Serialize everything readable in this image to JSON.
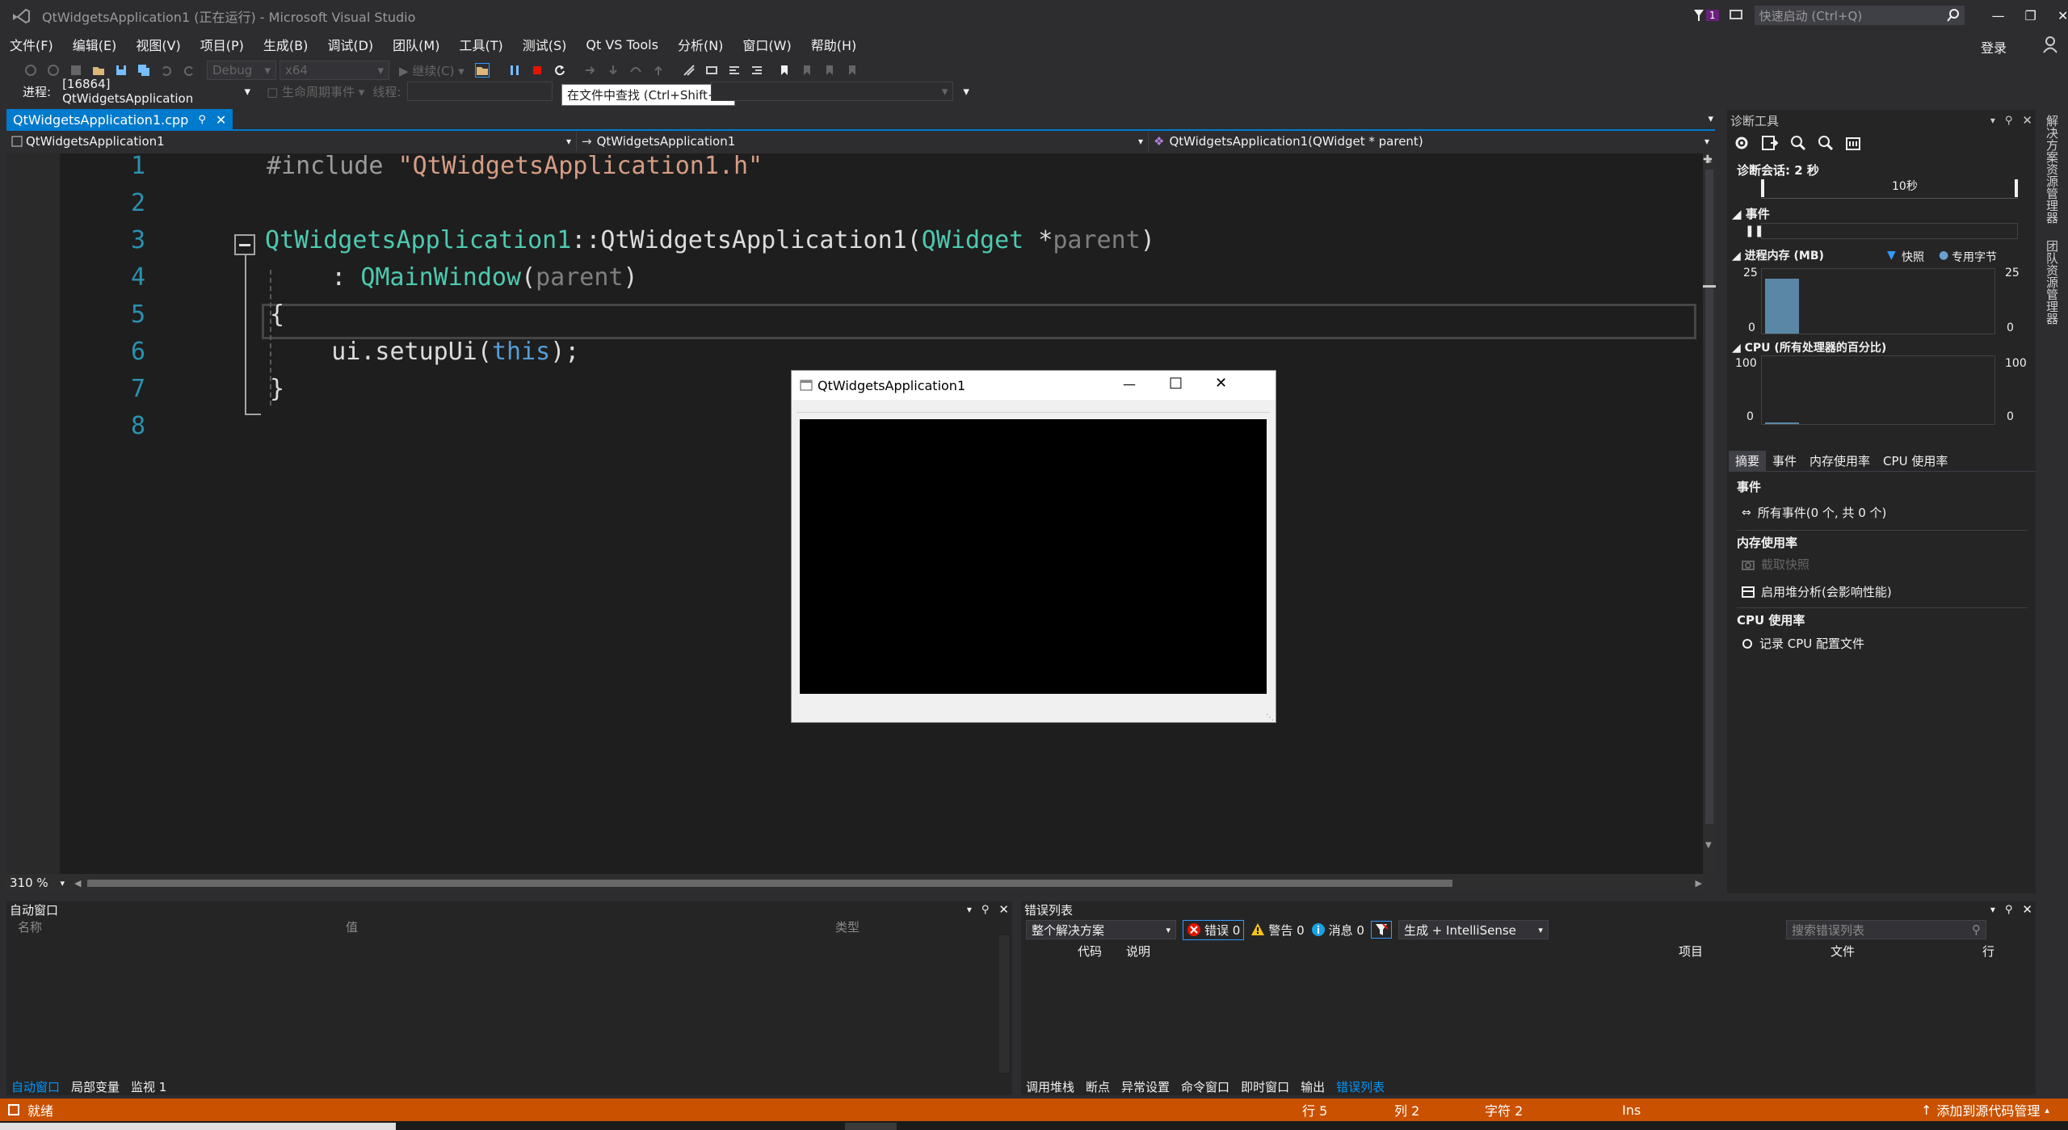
{
  "window": {
    "title": "QtWidgetsApplication1 (正在运行) - Microsoft Visual Studio",
    "notification_count": "1",
    "quick_launch_placeholder": "快速启动 (Ctrl+Q)",
    "login": "登录"
  },
  "menus": [
    "文件(F)",
    "编辑(E)",
    "视图(V)",
    "项目(P)",
    "生成(B)",
    "调试(D)",
    "团队(M)",
    "工具(T)",
    "测试(S)",
    "Qt VS Tools",
    "分析(N)",
    "窗口(W)",
    "帮助(H)"
  ],
  "toolbar": {
    "config": "Debug",
    "platform": "x64",
    "continue": "继续(C)",
    "tooltip": "在文件中查找 (Ctrl+Shift+F)"
  },
  "debugbar": {
    "process_label": "进程:",
    "process": "[16864] QtWidgetsApplication",
    "lifecycle": "生命周期事件",
    "thread_label": "线程:"
  },
  "editor": {
    "tab": "QtWidgetsApplication1.cpp",
    "nav_project": "QtWidgetsApplication1",
    "nav_scope": "QtWidgetsApplication1",
    "nav_member": "QtWidgetsApplication1(QWidget * parent)",
    "zoom": "310 %",
    "line_numbers": [
      "1",
      "2",
      "3",
      "4",
      "5",
      "6",
      "7",
      "8"
    ],
    "code": {
      "l1_pp": "#include ",
      "l1_str": "\"QtWidgetsApplication1.h\"",
      "l3_cls": "QtWidgetsApplication1",
      "l3_sep": "::",
      "l3_fn": "QtWidgetsApplication1",
      "l3_open": "(",
      "l3_type": "QWidget",
      "l3_star": " *",
      "l3_param": "parent",
      "l3_close": ")",
      "l4_colon": "    : ",
      "l4_cls": "QMainWindow",
      "l4_open": "(",
      "l4_param": "parent",
      "l4_close": ")",
      "l5": "{",
      "l6_pre": "    ui.setupUi(",
      "l6_kw": "this",
      "l6_post": ");",
      "l7": "}"
    }
  },
  "qt_window": {
    "title": "QtWidgetsApplication1"
  },
  "diagnostics": {
    "title": "诊断工具",
    "session": "诊断会话: 2 秒",
    "timeline_label": "10秒",
    "events_header": "事件",
    "memory_header": "进程内存 (MB)",
    "legend_snapshot": "快照",
    "legend_private": "专用字节",
    "mem_max": "25",
    "mem_min": "0",
    "cpu_header": "CPU (所有处理器的百分比)",
    "cpu_max": "100",
    "cpu_min": "0",
    "tabs": [
      "摘要",
      "事件",
      "内存使用率",
      "CPU 使用率"
    ],
    "sec_events": "事件",
    "all_events": "所有事件(0 个, 共 0 个)",
    "sec_memory": "内存使用率",
    "take_snapshot": "截取快照",
    "heap_profiling": "启用堆分析(会影响性能)",
    "sec_cpu": "CPU 使用率",
    "record_cpu": "记录 CPU 配置文件",
    "mem_level": 0.85
  },
  "side_strip": [
    "解决方案资源管理器",
    "团队资源管理器"
  ],
  "auto_window": {
    "title": "自动窗口",
    "columns": [
      "名称",
      "值",
      "类型"
    ],
    "tabs": [
      "自动窗口",
      "局部变量",
      "监视 1"
    ]
  },
  "error_list": {
    "title": "错误列表",
    "scope": "整个解决方案",
    "errors": "错误 0",
    "warnings": "警告 0",
    "messages": "消息 0",
    "build_filter": "生成 + IntelliSense",
    "search_placeholder": "搜索错误列表",
    "columns": [
      "代码",
      "说明",
      "项目",
      "文件",
      "行"
    ],
    "tabs": [
      "调用堆栈",
      "断点",
      "异常设置",
      "命令窗口",
      "即时窗口",
      "输出",
      "错误列表"
    ]
  },
  "status": {
    "ready": "就绪",
    "line": "行 5",
    "col": "列 2",
    "char": "字符 2",
    "ins": "Ins",
    "source_control": "添加到源代码管理"
  },
  "colors": {
    "accent": "#007acc",
    "status_bar": "#ca5100",
    "background": "#2d2d30",
    "editor": "#1e1e1e"
  }
}
